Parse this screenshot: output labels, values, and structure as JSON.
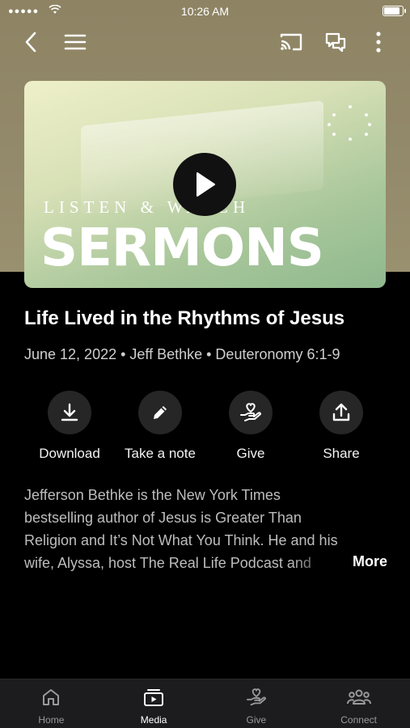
{
  "status_bar": {
    "time": "10:26 AM",
    "signal": "●●●●●",
    "battery_level": 0.95
  },
  "header": {
    "icons": [
      "back-icon",
      "menu-icon",
      "cast-icon",
      "chat-icon",
      "more-vertical-icon"
    ]
  },
  "artwork": {
    "kicker": "LISTEN & WATCH",
    "headline": "SERMONS"
  },
  "sermon": {
    "title": "Life Lived in the Rhythms of Jesus",
    "meta": "June 12, 2022 • Jeff Bethke • Deuteronomy 6:1-9"
  },
  "actions": [
    {
      "label": "Download",
      "icon": "download-icon"
    },
    {
      "label": "Take a note",
      "icon": "pencil-icon"
    },
    {
      "label": "Give",
      "icon": "give-heart-hand-icon"
    },
    {
      "label": "Share",
      "icon": "share-icon"
    }
  ],
  "description": {
    "lines": [
      "Jefferson Bethke is the New York Times",
      "bestselling author of Jesus is Greater Than",
      "Religion and It’s Not What You Think. He and his",
      "wife, Alyssa, host The Real Life Podcast and"
    ],
    "more_label": "More"
  },
  "tabs": [
    {
      "label": "Home",
      "icon": "home-icon",
      "active": false
    },
    {
      "label": "Media",
      "icon": "media-icon",
      "active": true
    },
    {
      "label": "Give",
      "icon": "give-icon",
      "active": false
    },
    {
      "label": "Connect",
      "icon": "connect-icon",
      "active": false
    }
  ]
}
